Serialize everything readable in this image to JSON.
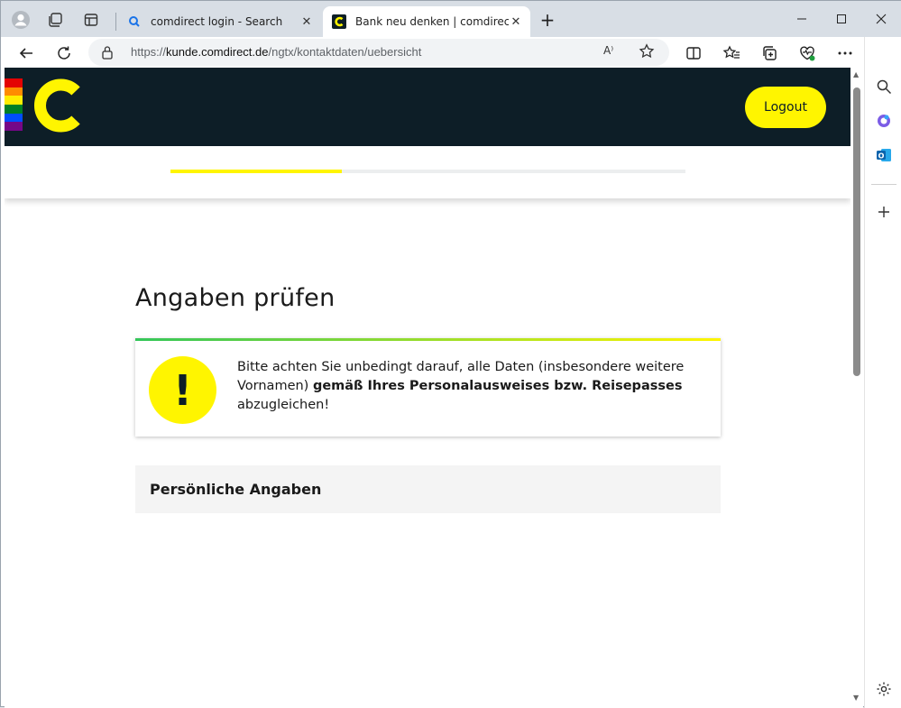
{
  "browser": {
    "tabs": [
      {
        "title": "comdirect login - Search",
        "active": false,
        "favicon": "search-icon"
      },
      {
        "title": "Bank neu denken | comdirect - e",
        "active": true,
        "favicon": "comdirect-favicon"
      }
    ],
    "new_tab_label": "+",
    "url_prefix": "https://",
    "url_host": "kunde.comdirect.de",
    "url_path": "/ngtx/kontaktdaten/uebersicht",
    "read_aloud_label": "A⁾"
  },
  "site": {
    "logout_label": "Logout",
    "progress_fraction": 0.333,
    "accent_color": "#fff500",
    "header_color": "#0d1e27"
  },
  "page": {
    "title": "Angaben prüfen",
    "alert": {
      "icon": "!",
      "text_before": "Bitte achten Sie unbedingt darauf, alle Daten (insbesondere weitere Vornamen) ",
      "text_bold": "gemäß Ihres Personalausweises bzw. Reisepasses",
      "text_after": " abzugleichen!"
    },
    "section_title": "Persönliche Angaben"
  }
}
